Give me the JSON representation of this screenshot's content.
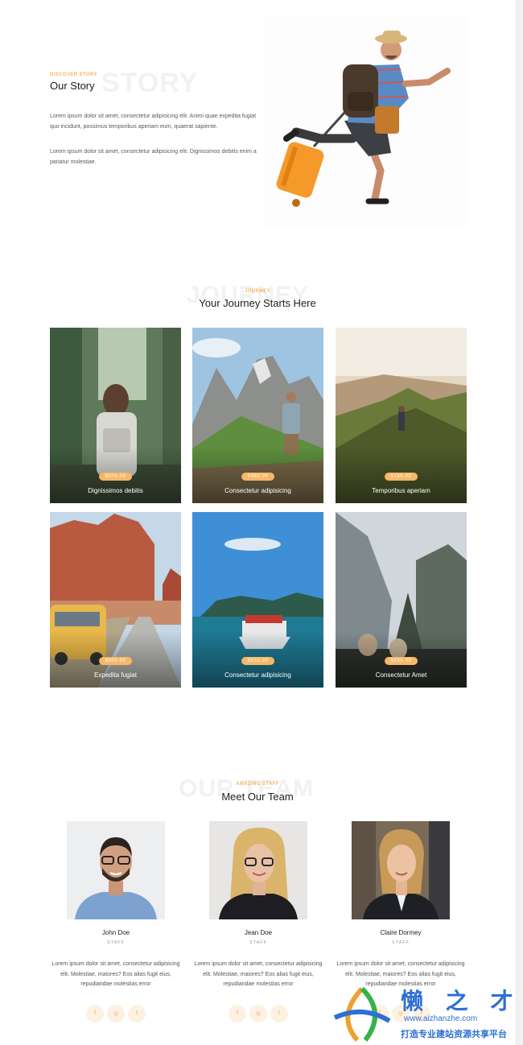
{
  "story": {
    "bg_word": "STORY",
    "eyebrow": "DISCOVER STORY",
    "title": "Our Story",
    "paragraph_1": "Lorem ipsum dolor sit amet, consectetur adipisicing elit. Animi quae expedita fugiat quo incidunt, possimus temporibus aperiam eum, quaerat sapiente.",
    "paragraph_2": "Lorem ipsum dolor sit amet, consectetur adipisicing elit. Dignissimos debitis enim a pariatur molestiae."
  },
  "journey": {
    "bg_word": "JOURNEY",
    "eyebrow": "JOURNEY",
    "title": "Your Journey Starts Here",
    "cards": [
      {
        "title": "Dignissimos debitis",
        "price": "$200.00"
      },
      {
        "title": "Consectetur adipisicing",
        "price": "$380.00"
      },
      {
        "title": "Temporibus aperiam",
        "price": "$150.00"
      },
      {
        "title": "Expedita fugiat",
        "price": "$600.00"
      },
      {
        "title": "Consectetur adipisicing",
        "price": "$530.00"
      },
      {
        "title": "Consectetur Amet",
        "price": "$650.00"
      }
    ]
  },
  "team": {
    "bg_word": "OUR TEAM",
    "eyebrow": "AMAZING STAFF",
    "title": "Meet Our Team",
    "members": [
      {
        "name": "John Doe",
        "role": "STAFF",
        "bio": "Lorem ipsum dolor sit amet, consectetur adipisicing elit. Molestiae, maiores? Eos alias fugit eius, repudiandae molestias error"
      },
      {
        "name": "Jean Doe",
        "role": "STAFF",
        "bio": "Lorem ipsum dolor sit amet, consectetur adipisicing elit. Molestiae, maiores? Eos alias fugit eius, repudiandae molestias error"
      },
      {
        "name": "Claire Dormey",
        "role": "STAFF",
        "bio": "Lorem ipsum dolor sit amet, consectetur adipisicing elit. Molestiae, maiores? Eos alias fugit eius, repudiandae molestias error"
      }
    ],
    "social_icons": [
      "facebook-icon",
      "instagram-icon",
      "twitter-icon"
    ],
    "social_glyphs": [
      "f",
      "◎",
      "t"
    ]
  },
  "watermark": {
    "text": "懒 之 才",
    "url": "www.aizhanzhe.com",
    "tagline": "打造专业建站资源共享平台"
  },
  "colors": {
    "accent": "#f6b866",
    "social_bg": "#fdf1e2",
    "watermark": "#2d6fd6"
  }
}
